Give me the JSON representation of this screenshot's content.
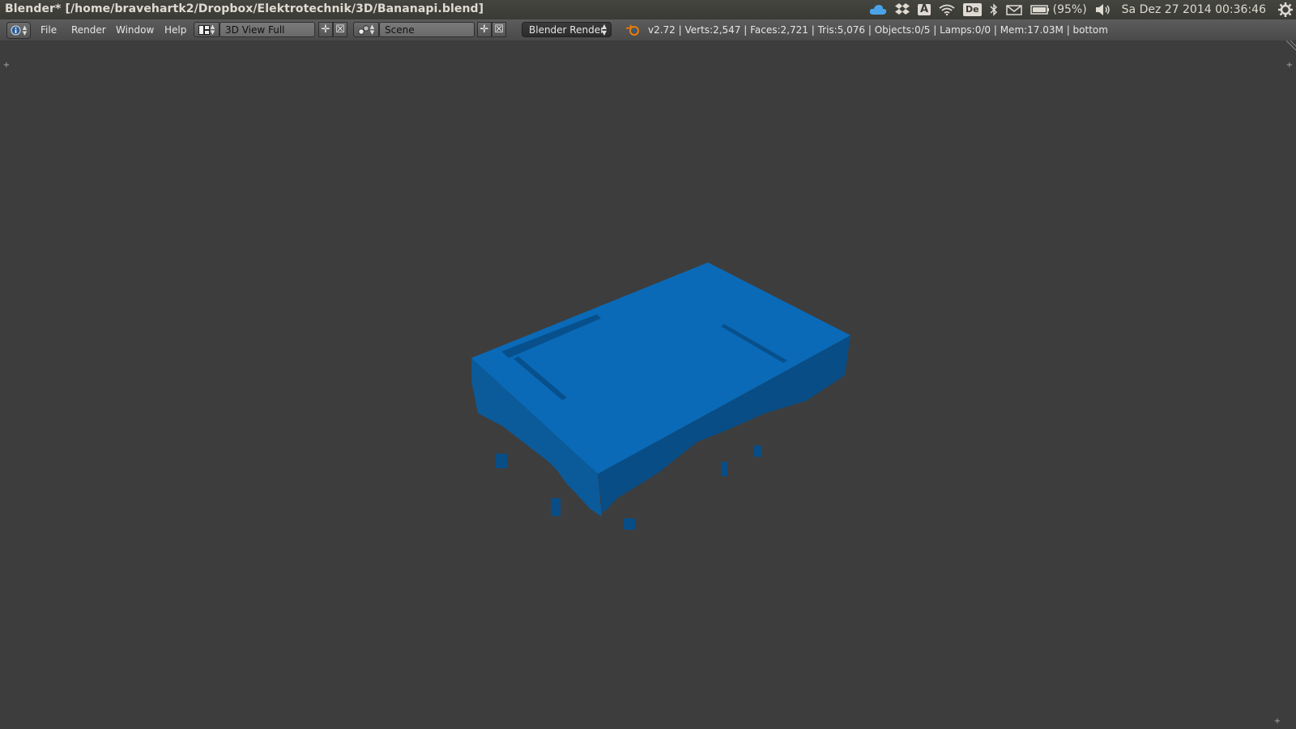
{
  "window": {
    "title": "Blender* [/home/bravehartk2/Dropbox/Elektrotechnik/3D/Bananapi.blend]"
  },
  "tray": {
    "keyboard_layout": "De",
    "battery_text": "(95%)",
    "datetime": "Sa Dez 27 2014 00:36:46",
    "icons": [
      "cloud-icon",
      "dropbox-icon",
      "text-input-icon",
      "wifi-icon",
      "keyboard-layout-icon",
      "bluetooth-icon",
      "mail-icon",
      "battery-icon",
      "volume-icon",
      "settings-gear-icon"
    ]
  },
  "header": {
    "menus": [
      "File",
      "Render",
      "Window",
      "Help"
    ],
    "screen_layout": "3D View Full",
    "scene": "Scene",
    "render_engine": "Blender Render",
    "stats": "v2.72 | Verts:2,547 | Faces:2,721 | Tris:5,076 | Objects:0/5 | Lamps:0/0 | Mem:17.03M | bottom"
  },
  "viewport": {
    "object_color": "#0a6ab7"
  }
}
